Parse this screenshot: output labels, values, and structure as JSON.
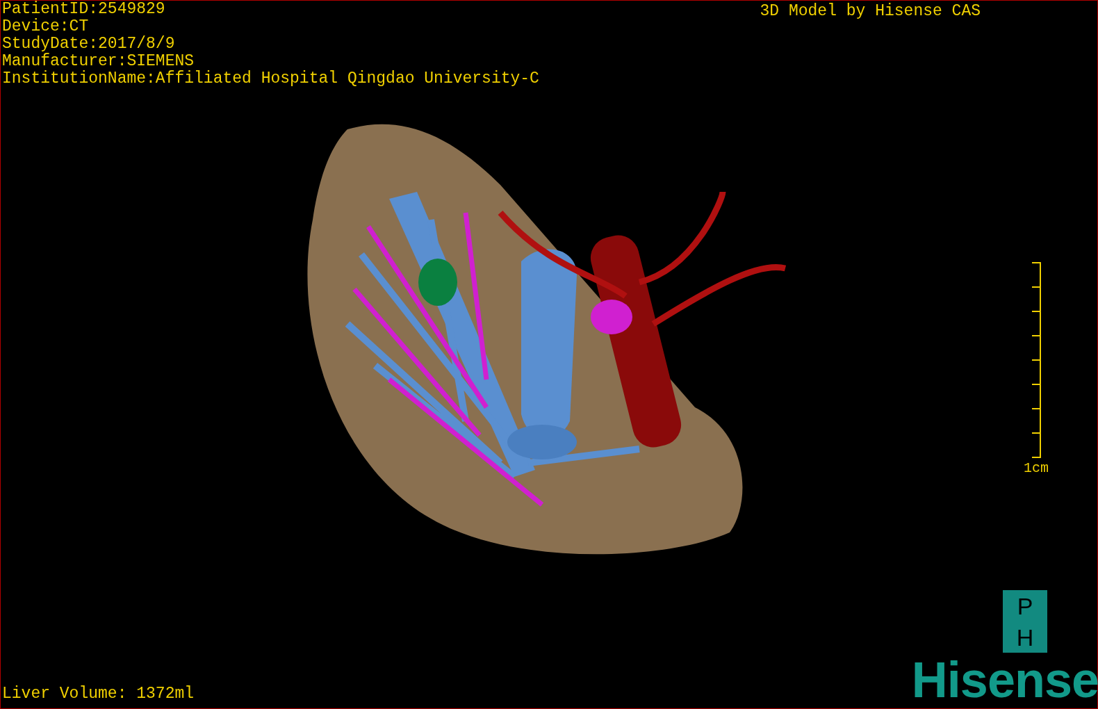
{
  "info_lines": [
    "PatientID:2549829",
    "Device:CT",
    "StudyDate:2017/8/9",
    "Manufacturer:SIEMENS",
    "InstitutionName:Affiliated Hospital Qingdao University-C"
  ],
  "title": "3D Model by Hisense CAS",
  "scale": {
    "label": "1cm"
  },
  "volume": "Liver Volume: 1372ml",
  "logo": {
    "badge": [
      "P",
      "H"
    ],
    "brand": "Hisense"
  }
}
